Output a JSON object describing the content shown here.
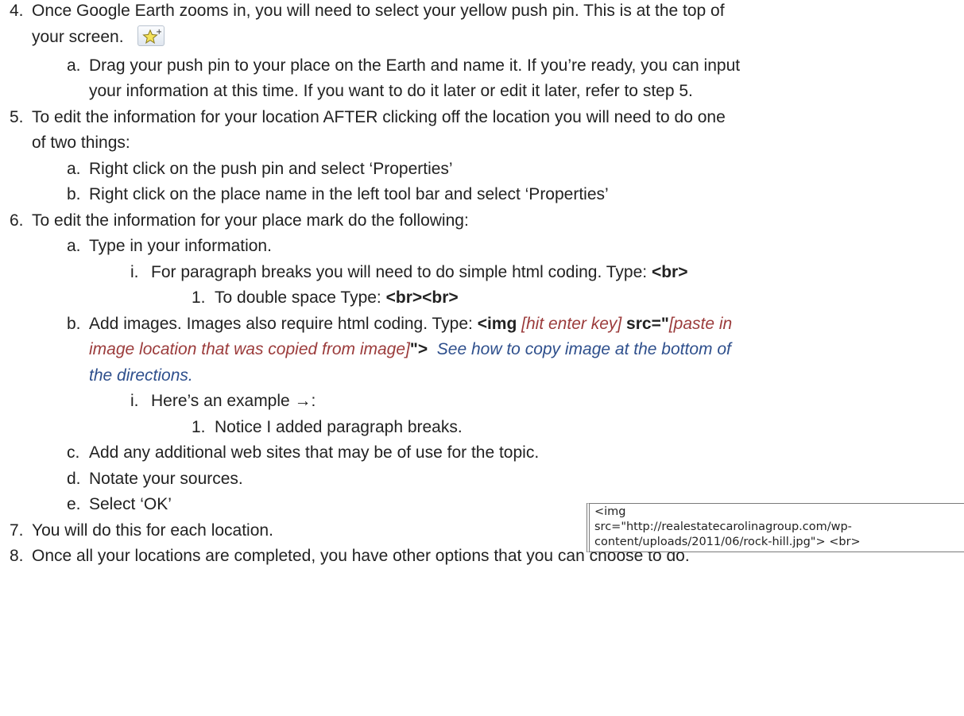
{
  "items": {
    "s4": {
      "num": "4.",
      "text_line1": "Once Google Earth zooms in, you will need to select your yellow push pin.  This is at the top of",
      "text_line2": "your screen.",
      "pin_icon": "add-placemark-icon",
      "a": {
        "num": "a.",
        "line1": "Drag your push pin to your place on the Earth and name it. If you’re ready, you can input",
        "line2": "your information at this time.  If you want to do it later or edit it later, refer to step 5."
      }
    },
    "s5": {
      "num": "5.",
      "line1": "To  edit the information for your location AFTER clicking off the location you will need to do one",
      "line2": "of two things:",
      "a": {
        "num": "a.",
        "text": "Right click on the push pin and select ‘Properties’"
      },
      "b": {
        "num": "b.",
        "text": "Right click on the place name in the left tool bar and select ‘Properties’"
      }
    },
    "s6": {
      "num": "6.",
      "text": "To edit the information for your place mark do the following:",
      "a": {
        "num": "a.",
        "text": "Type in your information.",
        "i": {
          "num": "i.",
          "text": "For paragraph breaks you will need to do simple html coding.  Type:  ",
          "code": "<br>",
          "one": {
            "num": "1.",
            "text": "To double space Type:  ",
            "code": "<br><br>"
          }
        }
      },
      "b": {
        "num": "b.",
        "text": "Add images.  Images also require html coding.  Type:  ",
        "code1": "<img",
        "hint1": " [hit enter key] ",
        "code2": "src=\"",
        "hint2_line1": "[paste in",
        "hint2_line2": "image location that was copied from image]",
        "code3": "\">",
        "note_line1": "See how to copy image at the bottom of",
        "note_line2": "the directions.",
        "i": {
          "num": "i.",
          "text": "Here’s an example ",
          "arrow": "→",
          "colon": ":",
          "one": {
            "num": "1.",
            "text": "Notice I added paragraph breaks."
          }
        },
        "example": {
          "line1": "<img",
          "line2": "src=\"http://realestatecarolinagroup.com/wp-",
          "line3": "content/uploads/2011/06/rock-hill.jpg\"> <br>"
        }
      },
      "c": {
        "num": "c.",
        "text": "Add any additional web sites that may be of use for the topic."
      },
      "d": {
        "num": "d.",
        "text": "Notate your sources."
      },
      "e": {
        "num": "e.",
        "text": "Select ‘OK’"
      }
    },
    "s7": {
      "num": "7.",
      "text": "You will do this for each location."
    },
    "s8": {
      "num": "8.",
      "text": "Once all your locations are completed, you have other options that you can choose to do."
    }
  },
  "colors": {
    "hint": "#9b3b3b",
    "note": "#2e4f8c",
    "text": "#222222"
  }
}
